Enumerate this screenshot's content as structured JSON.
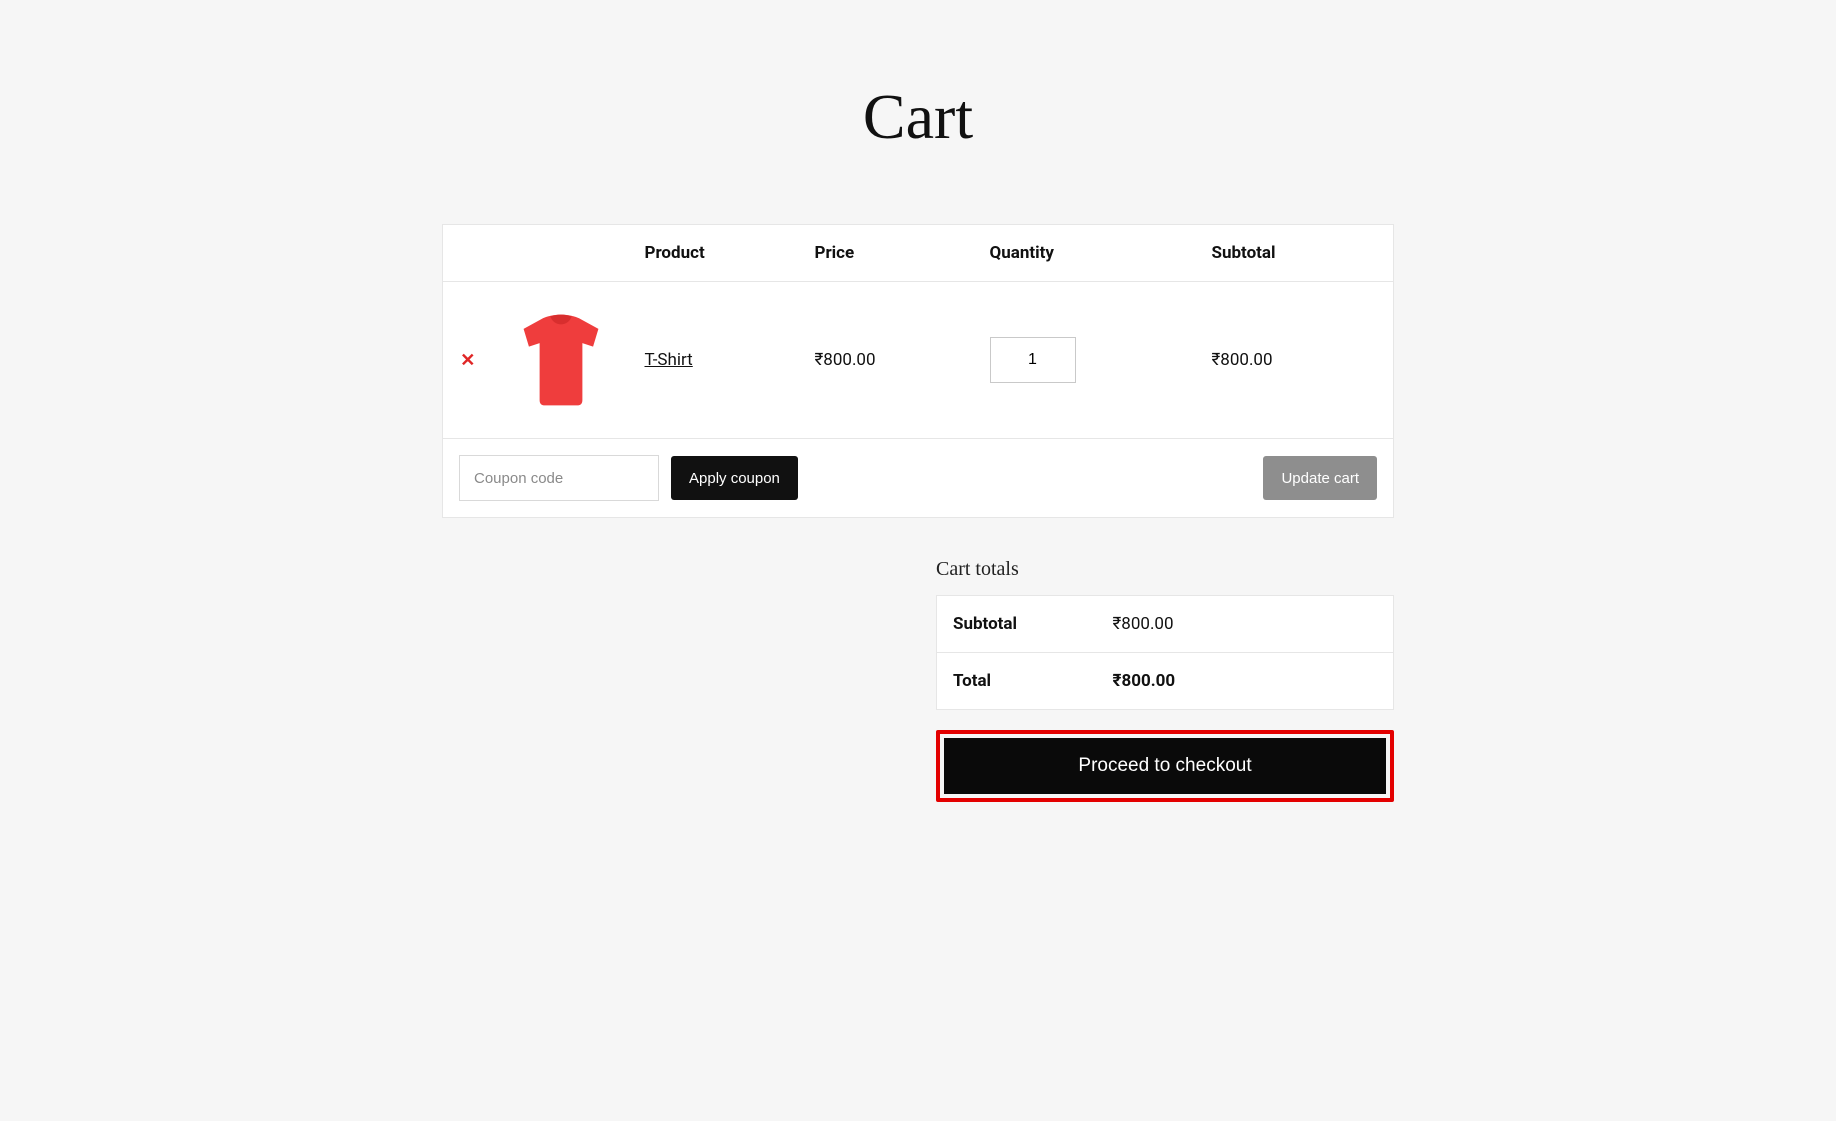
{
  "page": {
    "title": "Cart"
  },
  "table": {
    "headers": {
      "product": "Product",
      "price": "Price",
      "quantity": "Quantity",
      "subtotal": "Subtotal"
    },
    "rows": [
      {
        "remove_icon": "✕",
        "product_name": "T-Shirt",
        "price": "₹800.00",
        "quantity": "1",
        "subtotal": "₹800.00"
      }
    ]
  },
  "coupon": {
    "placeholder": "Coupon code",
    "apply_label": "Apply coupon"
  },
  "update_cart_label": "Update cart",
  "totals": {
    "title": "Cart totals",
    "subtotal_label": "Subtotal",
    "subtotal_value": "₹800.00",
    "total_label": "Total",
    "total_value": "₹800.00"
  },
  "checkout_label": "Proceed to checkout"
}
